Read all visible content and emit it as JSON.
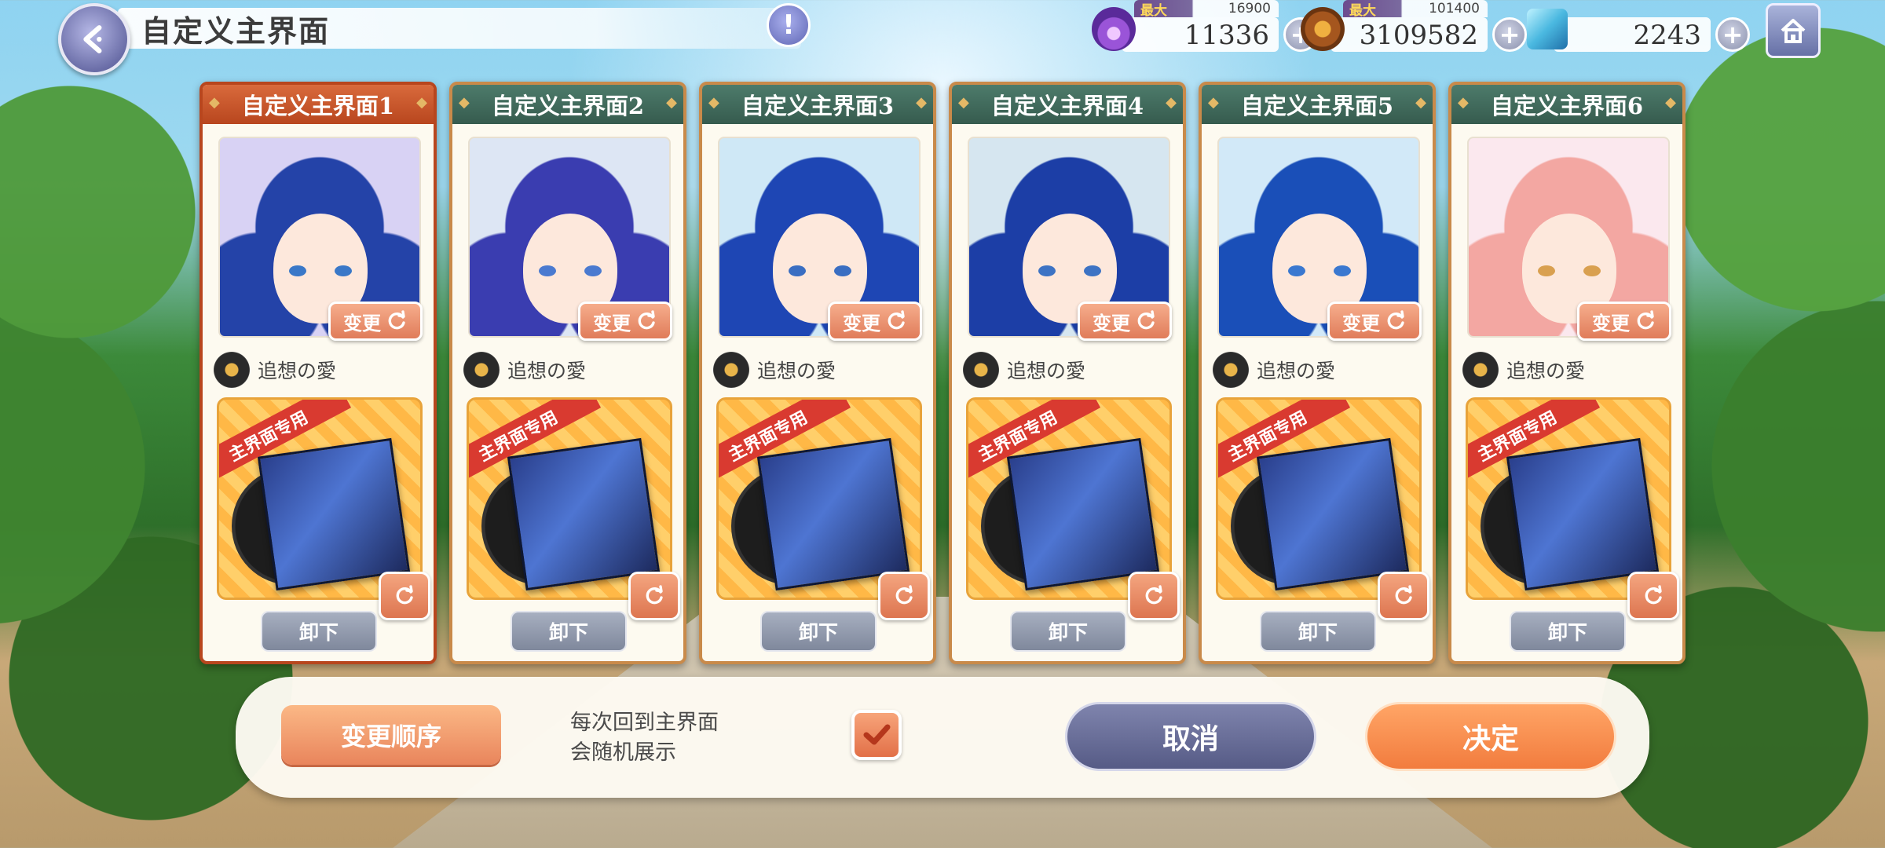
{
  "header": {
    "title": "自定义主界面",
    "info_glyph": "!"
  },
  "currencies": [
    {
      "name": "stamina",
      "icon": "purple-flame-icon",
      "max_label": "最大",
      "max_value": "16900",
      "value": "11336",
      "plus": "+"
    },
    {
      "name": "gold",
      "icon": "bear-coin-icon",
      "max_label": "最大",
      "max_value": "101400",
      "value": "3109582",
      "plus": "+"
    },
    {
      "name": "gem",
      "icon": "blue-cube-icon",
      "value": "2243",
      "plus": "+"
    }
  ],
  "cards": [
    {
      "title": "自定义主界面1",
      "change_label": "变更",
      "song": "追想の愛",
      "album_tag": "主界面专用",
      "unequip_label": "卸下",
      "selected": true
    },
    {
      "title": "自定义主界面2",
      "change_label": "变更",
      "song": "追想の愛",
      "album_tag": "主界面专用",
      "unequip_label": "卸下"
    },
    {
      "title": "自定义主界面3",
      "change_label": "变更",
      "song": "追想の愛",
      "album_tag": "主界面专用",
      "unequip_label": "卸下"
    },
    {
      "title": "自定义主界面4",
      "change_label": "变更",
      "song": "追想の愛",
      "album_tag": "主界面专用",
      "unequip_label": "卸下"
    },
    {
      "title": "自定义主界面5",
      "change_label": "变更",
      "song": "追想の愛",
      "album_tag": "主界面专用",
      "unequip_label": "卸下"
    },
    {
      "title": "自定义主界面6",
      "change_label": "变更",
      "song": "追想の愛",
      "album_tag": "主界面专用",
      "unequip_label": "卸下"
    }
  ],
  "colors": {
    "hair": [
      "#2443a8",
      "#3a3db0",
      "#1e46b4",
      "#1c3ea6",
      "#1a4fb8",
      "#f3a7a2"
    ],
    "portrait_bg": [
      "#d8d2f4",
      "#dde6f4",
      "#cfe8f6",
      "#d6e6f0",
      "#d2e9f8",
      "#fbe8ee"
    ],
    "eye": [
      "#3a78c8",
      "#4a7ad0",
      "#3a6ec2",
      "#3d73c4",
      "#3a78d0",
      "#d9a050"
    ]
  },
  "footer": {
    "reorder_label": "变更顺序",
    "random_label": "每次回到主界面\n会随机展示",
    "random_checked": true,
    "cancel_label": "取消",
    "confirm_label": "决定"
  }
}
